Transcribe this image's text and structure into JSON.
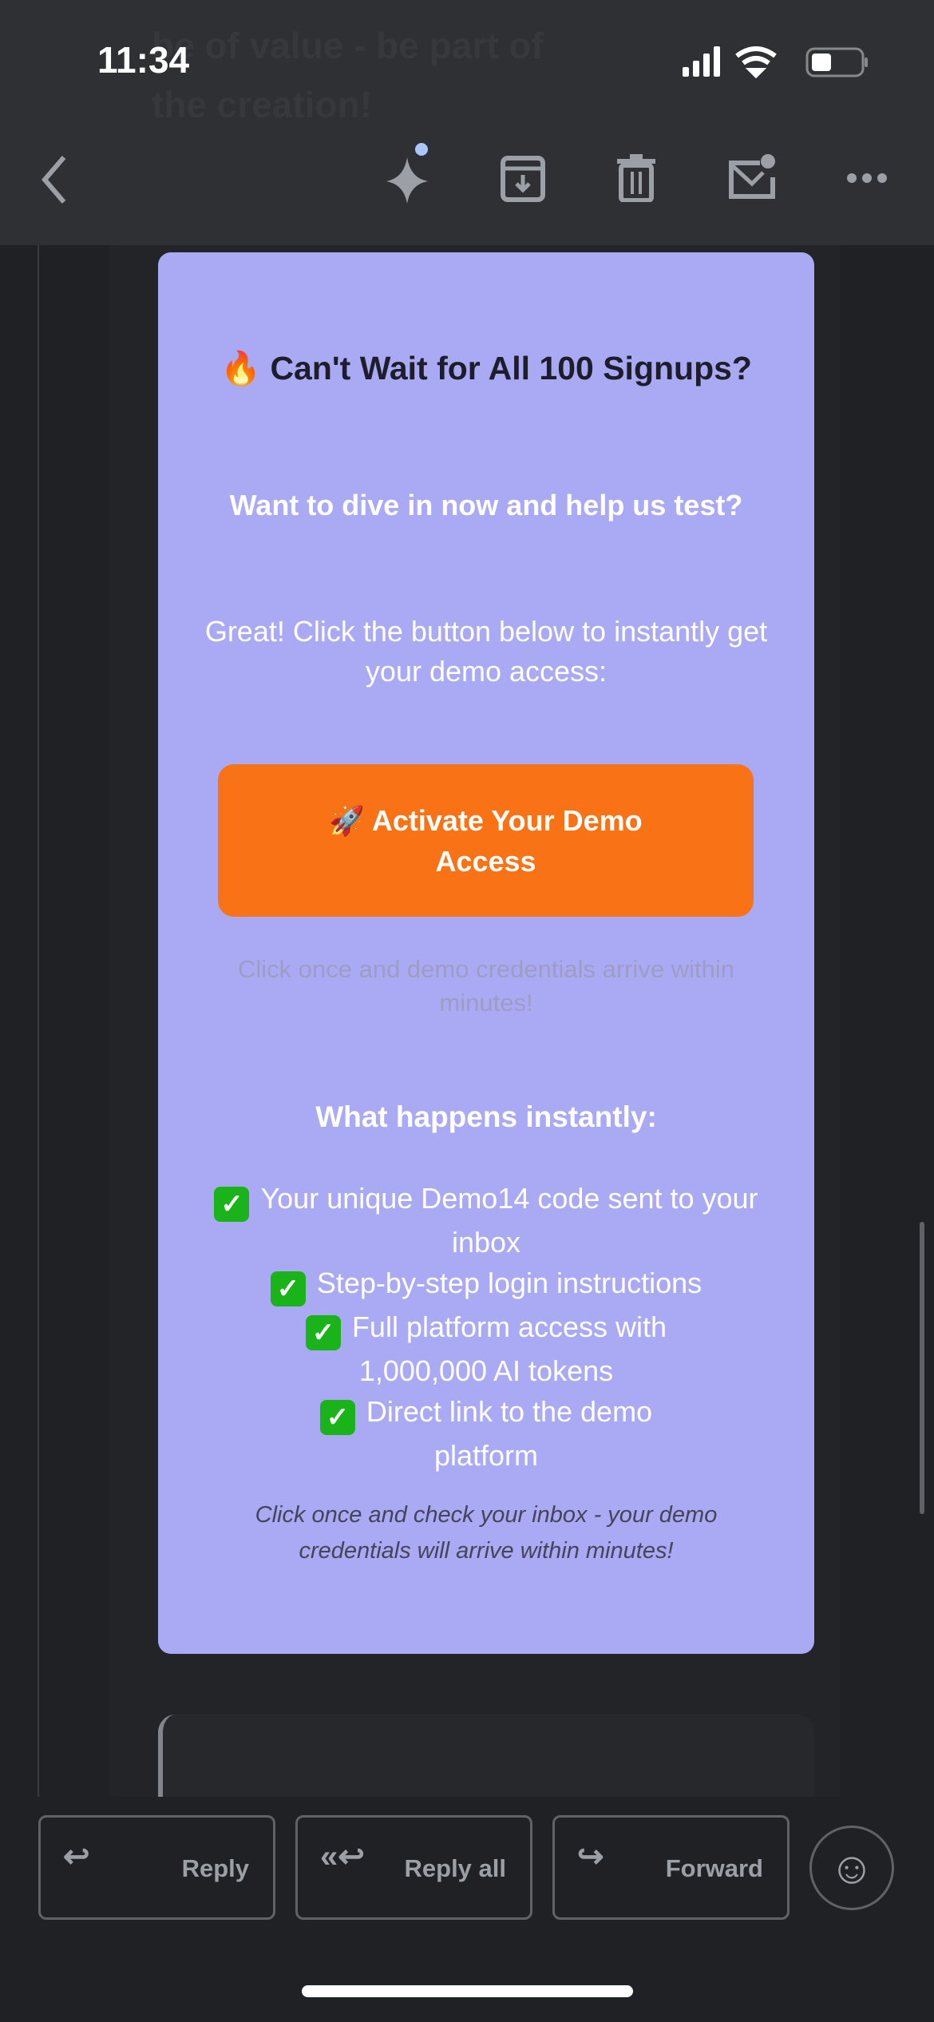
{
  "status_bar": {
    "time": "11:34",
    "battery_level": 0.35
  },
  "ghost_text": "be of value - be part of the creation!",
  "toolbar": {
    "icons": [
      "back-icon",
      "gemini-sparkle-icon",
      "archive-icon",
      "delete-icon",
      "mark-unread-icon",
      "more-icon"
    ]
  },
  "card": {
    "background": "#aaaaf4",
    "title": "🔥 Can't Wait for All 100 Signups?",
    "subtitle": "Want to dive in now and help us test?",
    "intro": "Great! Click the button below to instantly get your demo access:",
    "cta_label": "🚀 Activate Your Demo Access",
    "cta_color": "#f97316",
    "note": "Click once and demo credentials arrive within minutes!",
    "list_heading": "What happens instantly:",
    "list": [
      "Your unique Demo14 code sent to your inbox",
      "Step-by-step login instructions",
      "Full platform access with 1,000,000 AI tokens",
      "Direct link to the demo platform"
    ],
    "footer": "Click once and check your inbox - your demo credentials will arrive within minutes!"
  },
  "actions": {
    "reply": "Reply",
    "reply_all": "Reply all",
    "forward": "Forward"
  }
}
